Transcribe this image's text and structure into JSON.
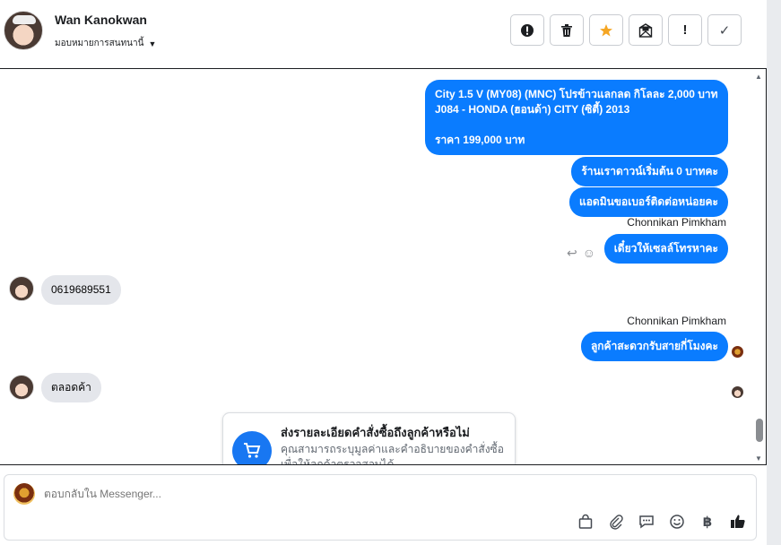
{
  "header": {
    "contact_name": "Wan Kanokwan",
    "assign_label": "มอบหมายการสนทนานี้",
    "actions": [
      "spam-report",
      "delete",
      "star",
      "mark-unread",
      "important",
      "done"
    ],
    "action_glyphs": {
      "important": "!",
      "done": "✓"
    }
  },
  "messages": {
    "m1_line1": "City 1.5 V (MY08) (MNC) โปรข้าวแลกลด กิโลละ 2,000 บาท",
    "m1_line2": "J084 - HONDA (ฮอนด้า) CITY (ซิตี้) 2013",
    "m1_line3": "ราคา 199,000 บาท",
    "m2": "ร้านเราดาวน์เริ่มต้น 0 บาทคะ",
    "m3": "แอดมินขอเบอร์ติดต่อหน่อยคะ",
    "sender1": "Chonnikan Pimkham",
    "m4": "เดี๋ยวให้เซลล์โทรหาคะ",
    "in1": "0619689551",
    "sender2": "Chonnikan Pimkham",
    "m5": "ลูกค้าสะดวกรับสายกี่โมงคะ",
    "in2": "ตลอดค้า"
  },
  "card": {
    "title": "ส่งรายละเอียดคำสั่งซื้อถึงลูกค้าหรือไม่",
    "description": "คุณสามารถระบุมูลค่าและคำอธิบายของคำสั่งซื้อ เพื่อให้ลูกค้าตรวจสอบได้"
  },
  "composer": {
    "placeholder": "ตอบกลับใน Messenger...",
    "tools": [
      "shopping-bag",
      "attachment",
      "saved-reply",
      "emoji",
      "baht-payment",
      "like"
    ],
    "baht_glyph": "฿"
  },
  "colors": {
    "outgoing_bubble": "#0a7cff",
    "incoming_bubble": "#e4e6eb",
    "star": "#f5a623",
    "card_icon": "#1877f2"
  }
}
